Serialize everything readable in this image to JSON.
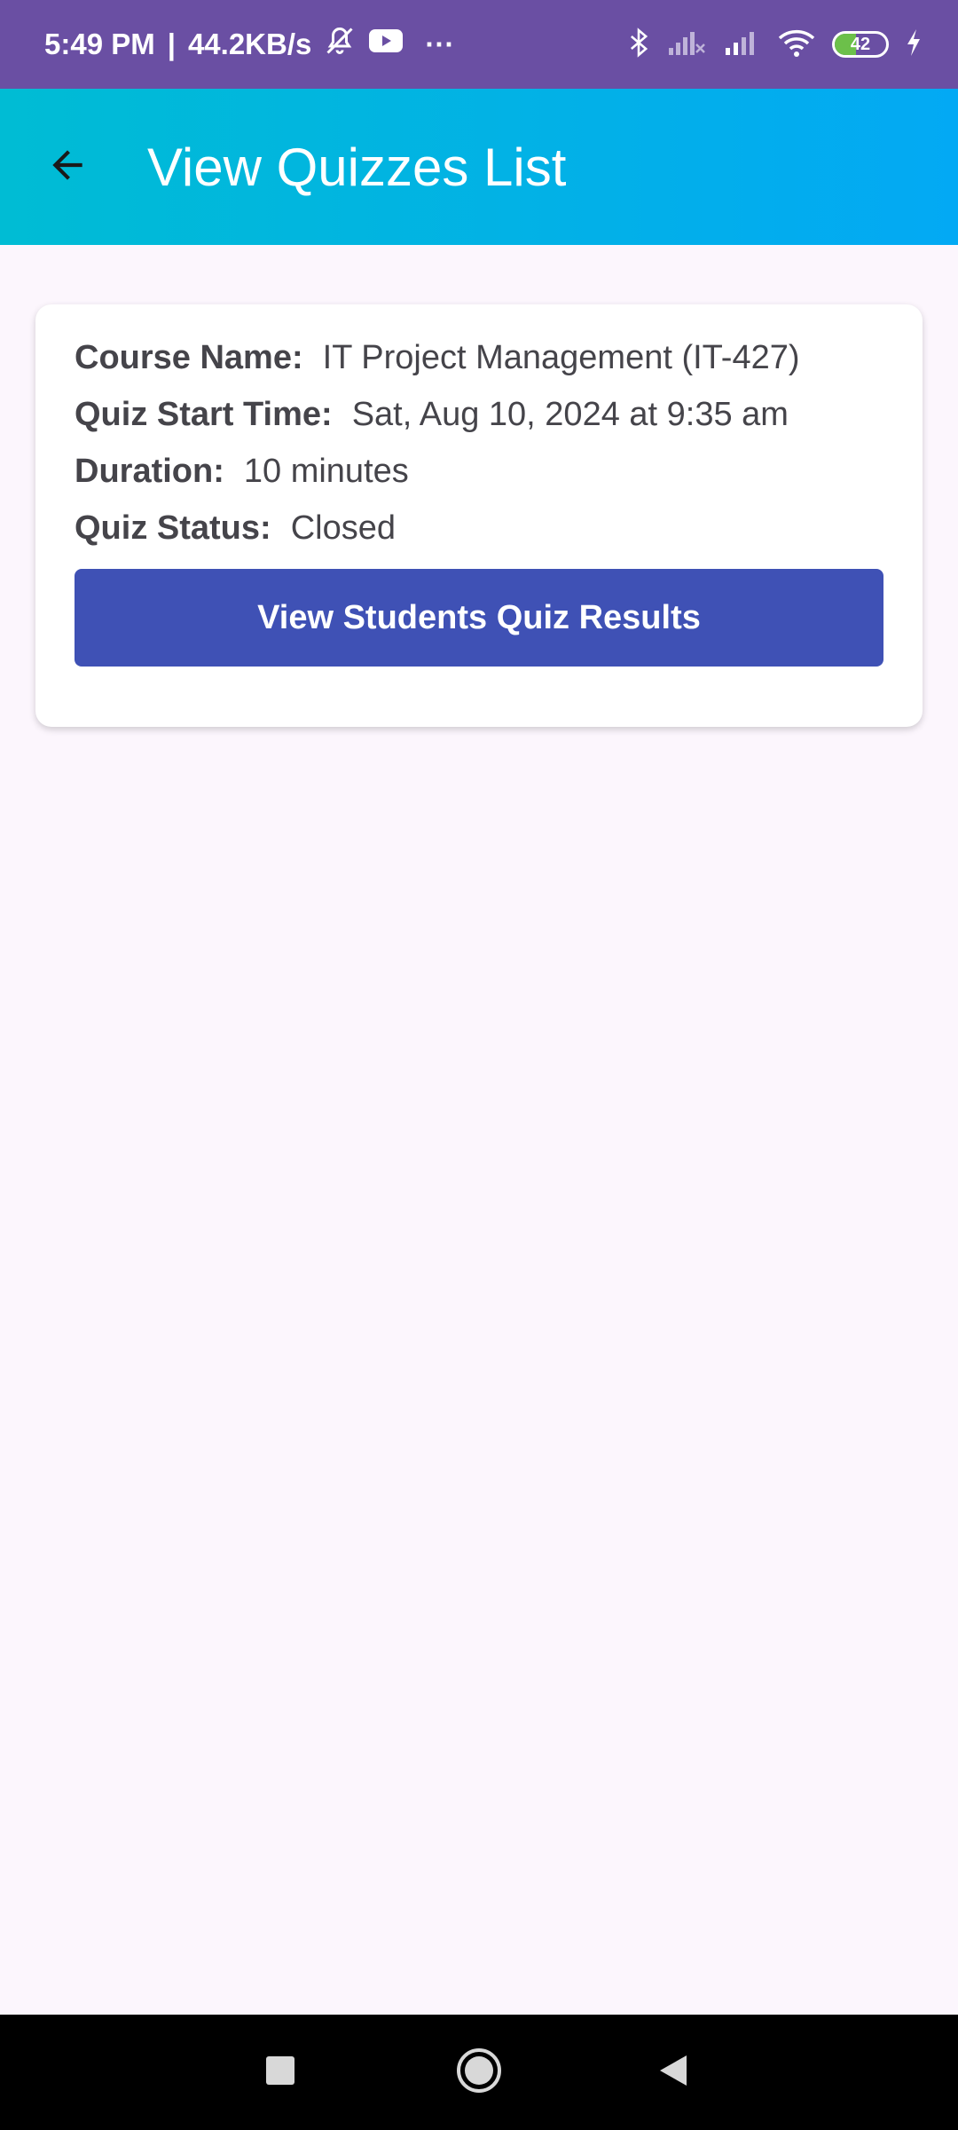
{
  "status_bar": {
    "time": "5:49 PM",
    "separator": "|",
    "network_speed": "44.2KB/s",
    "more": "···",
    "battery_level": "42",
    "battery_fraction": 0.42,
    "icons": [
      "mute-icon",
      "youtube-icon",
      "bluetooth-icon",
      "signal-icon",
      "wifi-icon",
      "battery-icon",
      "charging-icon"
    ]
  },
  "app_bar": {
    "title": "View Quizzes List",
    "back_icon": "arrow-back-icon",
    "gradient": [
      "#00BCD4",
      "#03A9F4"
    ]
  },
  "quiz_card": {
    "course_label": "Course Name:",
    "course_value": "IT Project Management (IT-427)",
    "start_label": "Quiz Start Time:",
    "start_value": "Sat, Aug 10, 2024 at 9:35 am",
    "duration_label": "Duration:",
    "duration_value": "10 minutes",
    "status_label": "Quiz Status:",
    "status_value": "Closed",
    "button_label": "View Students Quiz Results"
  },
  "nav_bar": {
    "items": [
      "recents-icon",
      "home-icon",
      "back-triangle-icon"
    ]
  },
  "colors": {
    "status_bar": "#6A4FA3",
    "background": "#FCF6FD",
    "button": "#3F51B5",
    "text": "#45444A"
  }
}
